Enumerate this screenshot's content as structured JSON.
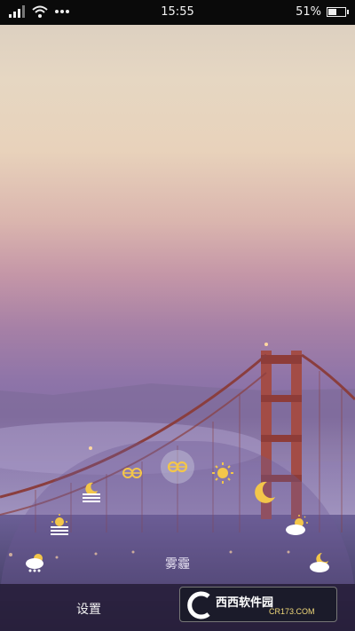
{
  "status_bar": {
    "time": "15:55",
    "battery_percent": "51%",
    "battery_level": 0.51,
    "icons": [
      "signal-icon",
      "wifi-icon",
      "more-dots-icon",
      "battery-icon"
    ]
  },
  "weather_picker": {
    "current_label": "雾霾",
    "selected_icon": "haze-icon",
    "icons": [
      "snow-cloud-icon",
      "moon-fog-icon",
      "sun-fog-icon",
      "haze-icon",
      "haze-icon",
      "sun-icon",
      "moon-icon",
      "sun-cloud-icon",
      "moon-cloud-icon"
    ],
    "colors": {
      "accent": "#f3c64a",
      "arc": "#6e5a96"
    }
  },
  "bottom_bar": {
    "settings_label": "设置"
  },
  "watermark": {
    "brand": "西西软件园",
    "url": "CR173.COM"
  }
}
